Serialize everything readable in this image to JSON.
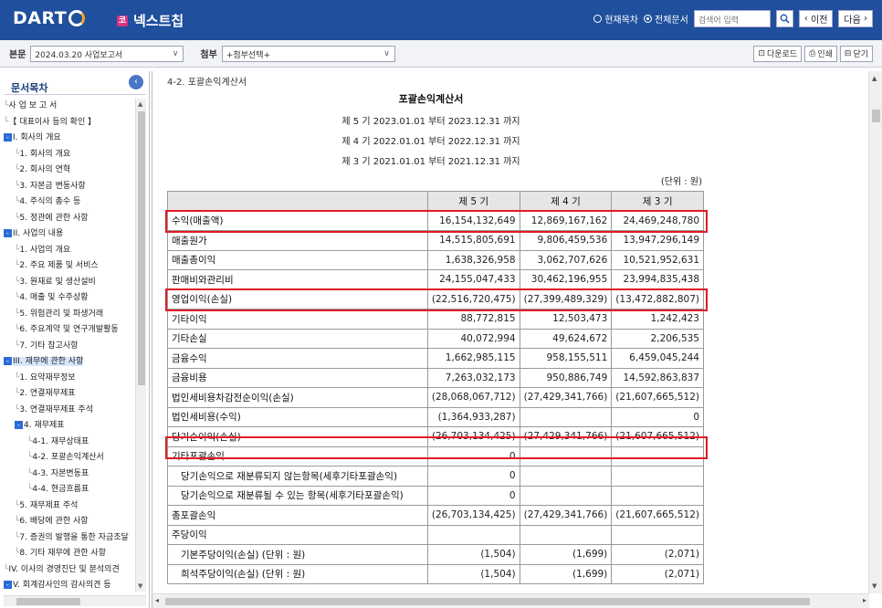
{
  "header": {
    "logo": "DART",
    "company_badge": "코",
    "company": "넥스트칩",
    "radio_current": "현재목차",
    "radio_all": "전체문서",
    "search_placeholder": "검색어 입력",
    "prev": "이전",
    "next": "다음"
  },
  "toolbar": {
    "main_label": "본문",
    "main_select": "2024.03.20 사업보고서",
    "attach_label": "첨부",
    "attach_select": "+첨부선택+",
    "download": "다운로드",
    "print": "인쇄",
    "close": "닫기"
  },
  "sidebar": {
    "title": "문서목차",
    "items": [
      {
        "text": "사 업 보 고 서",
        "level": 0,
        "box": ""
      },
      {
        "text": "【 대표이사 등의 확인 】",
        "level": 0,
        "box": ""
      },
      {
        "text": "I. 회사의 개요",
        "level": 0,
        "box": "-"
      },
      {
        "text": "1. 회사의 개요",
        "level": 1,
        "box": ""
      },
      {
        "text": "2. 회사의 연혁",
        "level": 1,
        "box": ""
      },
      {
        "text": "3. 자본금 변동사항",
        "level": 1,
        "box": ""
      },
      {
        "text": "4. 주식의 총수 등",
        "level": 1,
        "box": ""
      },
      {
        "text": "5. 정관에 관한 사항",
        "level": 1,
        "box": ""
      },
      {
        "text": "II. 사업의 내용",
        "level": 0,
        "box": "-"
      },
      {
        "text": "1. 사업의 개요",
        "level": 1,
        "box": ""
      },
      {
        "text": "2. 주요 제품 및 서비스",
        "level": 1,
        "box": ""
      },
      {
        "text": "3. 원재료 및 생산설비",
        "level": 1,
        "box": ""
      },
      {
        "text": "4. 매출 및 수주상황",
        "level": 1,
        "box": ""
      },
      {
        "text": "5. 위험관리 및 파생거래",
        "level": 1,
        "box": ""
      },
      {
        "text": "6. 주요계약 및 연구개발활동",
        "level": 1,
        "box": ""
      },
      {
        "text": "7. 기타 참고사항",
        "level": 1,
        "box": ""
      },
      {
        "text": "III. 재무에 관한 사항",
        "level": 0,
        "box": "-",
        "selected": true
      },
      {
        "text": "1. 요약재무정보",
        "level": 1,
        "box": ""
      },
      {
        "text": "2. 연결재무제표",
        "level": 1,
        "box": ""
      },
      {
        "text": "3. 연결재무제표 주석",
        "level": 1,
        "box": ""
      },
      {
        "text": "4. 재무제표",
        "level": 1,
        "box": "-"
      },
      {
        "text": "4-1. 재무상태표",
        "level": 2,
        "box": ""
      },
      {
        "text": "4-2. 포괄손익계산서",
        "level": 2,
        "box": ""
      },
      {
        "text": "4-3. 자본변동표",
        "level": 2,
        "box": ""
      },
      {
        "text": "4-4. 현금흐름표",
        "level": 2,
        "box": ""
      },
      {
        "text": "5. 재무제표 주석",
        "level": 1,
        "box": ""
      },
      {
        "text": "6. 배당에 관한 사항",
        "level": 1,
        "box": ""
      },
      {
        "text": "7. 증권의 발행을 통한 자금조달",
        "level": 1,
        "box": ""
      },
      {
        "text": "8. 기타 재무에 관한 사항",
        "level": 1,
        "box": ""
      },
      {
        "text": "IV. 이사의 경영진단 및 분석의견",
        "level": 0,
        "box": ""
      },
      {
        "text": "V. 회계감사인의 감사의견 등",
        "level": 0,
        "box": "-"
      }
    ]
  },
  "doc": {
    "top_cut": "4-2. 포괄손익계산서",
    "title": "포괄손익계산서",
    "periods": [
      "제 5 기 2023.01.01 부터 2023.12.31 까지",
      "제 4 기 2022.01.01 부터 2022.12.31 까지",
      "제 3 기 2021.01.01 부터 2021.12.31 까지"
    ],
    "unit": "(단위 : 원)",
    "columns": [
      "",
      "제 5 기",
      "제 4 기",
      "제 3 기"
    ],
    "rows": [
      {
        "label": "수익(매출액)",
        "v5": "16,154,132,649",
        "v4": "12,869,167,162",
        "v3": "24,469,248,780",
        "highlight": true
      },
      {
        "label": "매출원가",
        "v5": "14,515,805,691",
        "v4": "9,806,459,536",
        "v3": "13,947,296,149"
      },
      {
        "label": "매출총이익",
        "v5": "1,638,326,958",
        "v4": "3,062,707,626",
        "v3": "10,521,952,631"
      },
      {
        "label": "판매비와관리비",
        "v5": "24,155,047,433",
        "v4": "30,462,196,955",
        "v3": "23,994,835,438"
      },
      {
        "label": "영업이익(손실)",
        "v5": "(22,516,720,475)",
        "v4": "(27,399,489,329)",
        "v3": "(13,472,882,807)",
        "highlight": true
      },
      {
        "label": "기타이익",
        "v5": "88,772,815",
        "v4": "12,503,473",
        "v3": "1,242,423"
      },
      {
        "label": "기타손실",
        "v5": "40,072,994",
        "v4": "49,624,672",
        "v3": "2,206,535"
      },
      {
        "label": "금융수익",
        "v5": "1,662,985,115",
        "v4": "958,155,511",
        "v3": "6,459,045,244"
      },
      {
        "label": "금융비용",
        "v5": "7,263,032,173",
        "v4": "950,886,749",
        "v3": "14,592,863,837"
      },
      {
        "label": "법인세비용차감전순이익(손실)",
        "v5": "(28,068,067,712)",
        "v4": "(27,429,341,766)",
        "v3": "(21,607,665,512)"
      },
      {
        "label": "법인세비용(수익)",
        "v5": "(1,364,933,287)",
        "v4": "",
        "v3": "0"
      },
      {
        "label": "당기순이익(손실)",
        "v5": "(26,703,134,425)",
        "v4": "(27,429,341,766)",
        "v3": "(21,607,665,512)",
        "highlight": true
      },
      {
        "label": "기타포괄손익",
        "v5": "0",
        "v4": "",
        "v3": ""
      },
      {
        "label": "당기손익으로 재분류되지 않는항목(세후기타포괄손익)",
        "v5": "0",
        "v4": "",
        "v3": "",
        "indent": true
      },
      {
        "label": "당기손익으로 재분류될 수 있는 항목(세후기타포괄손익)",
        "v5": "0",
        "v4": "",
        "v3": "",
        "indent": true
      },
      {
        "label": "총포괄손익",
        "v5": "(26,703,134,425)",
        "v4": "(27,429,341,766)",
        "v3": "(21,607,665,512)"
      },
      {
        "label": "주당이익",
        "v5": "",
        "v4": "",
        "v3": ""
      },
      {
        "label": "기본주당이익(손실) (단위 : 원)",
        "v5": "(1,504)",
        "v4": "(1,699)",
        "v3": "(2,071)",
        "indent": true
      },
      {
        "label": "희석주당이익(손실) (단위 : 원)",
        "v5": "(1,504)",
        "v4": "(1,699)",
        "v3": "(2,071)",
        "indent": true
      }
    ]
  },
  "colors": {
    "header_bg": "#1f4f9d",
    "highlight": "#e01b24",
    "table_head_bg": "#e6e6e6"
  }
}
